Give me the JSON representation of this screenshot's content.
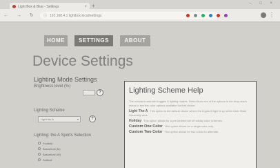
{
  "browser": {
    "tab_title": "Light Box & Blue - Settings",
    "tab_close": "×",
    "new_tab": "+",
    "window_controls": "– □ ×",
    "nav_glyphs": "← → ↻ ⌂",
    "url": "192.168.4.1   lightbox.local/settings",
    "lock_glyph": "ⓘ",
    "menu_glyph": "⋮",
    "extension_colors": [
      "#c0392b",
      "#7f8c8d",
      "#27ae60",
      "#2c7fb8",
      "#c0392b",
      "#8e44ad"
    ]
  },
  "nav": {
    "home": "HOME",
    "settings": "SETTINGS",
    "about": "ABOUT"
  },
  "page_title": "Device Settings",
  "lighting_mode": {
    "title": "Lighting Mode Settings",
    "brightness_label": "Brightness level (%)",
    "help_glyph": "?",
    "scheme_label": "Lighting Scheme",
    "scheme_value": "Light the A",
    "select_arrow": "▾",
    "sports_label": "Lighting: the A Sports Selection",
    "sports": [
      "Football",
      "Basketball (M)",
      "Basketball (W)",
      "Softball"
    ]
  },
  "help": {
    "title": "Lighting Scheme Help",
    "intro": "The onboard controller toggles 6 lighting modes. Select from one of the options in the drop-down menu to see the color options available for that choice.",
    "items": [
      {
        "name": "Light The A",
        "text": "This option is the default choice where the A gets lit light to up when Utah State University wins."
      },
      {
        "name": "Holiday",
        "text": "This option allows for a pre-defined set of holiday color schemes."
      },
      {
        "name": "Custom One Color",
        "text": "This option allows for a single color only."
      },
      {
        "name": "Custom Two Color",
        "text": "This option allows for two colors to alternate."
      }
    ]
  }
}
